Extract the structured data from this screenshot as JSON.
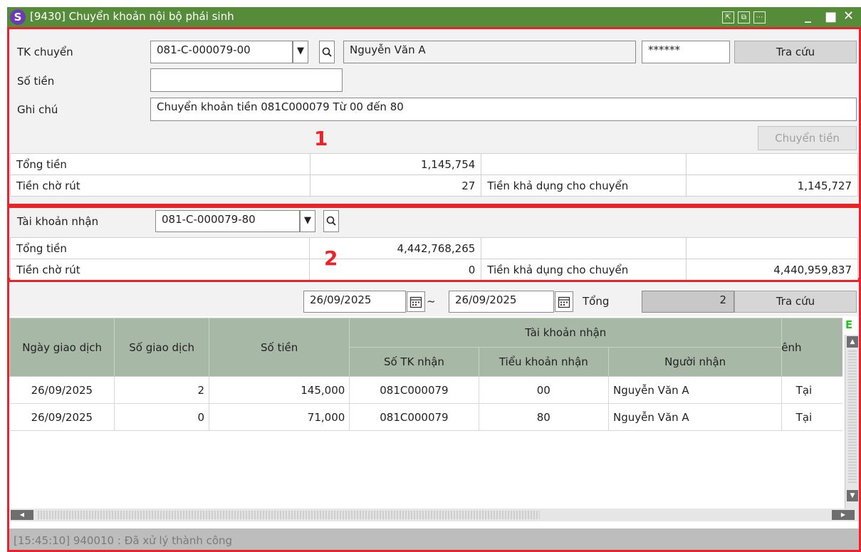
{
  "window": {
    "logo": "S",
    "title": "[9430] Chuyển khoản nội bộ phái sinh",
    "colors": {
      "titlebar": "#568b3a",
      "highlight": "#e8232a",
      "header": "#a8b8a6"
    }
  },
  "section1": {
    "marker": "1",
    "tk_chuyen_label": "TK chuyển",
    "tk_chuyen_value": "081-C-000079-00",
    "name_value": "Nguyễn Văn A",
    "password_value": "******",
    "lookup_button": "Tra cứu",
    "so_tien_label": "Số tiền",
    "so_tien_value": "",
    "ghi_chu_label": "Ghi chú",
    "ghi_chu_value": "Chuyển khoản tiền 081C000079 Từ 00 đến 80",
    "transfer_button": "Chuyển tiền",
    "tong_tien_label": "Tổng tiền",
    "tong_tien_value": "1,145,754",
    "tien_cho_rut_label": "Tiền chờ rút",
    "tien_cho_rut_value": "27",
    "tien_kha_dung_label": "Tiền khả dụng cho chuyển",
    "tien_kha_dung_value": "1,145,727"
  },
  "section2": {
    "marker": "2",
    "tk_nhan_label": "Tài khoản nhận",
    "tk_nhan_value": "081-C-000079-80",
    "tong_tien_label": "Tổng tiền",
    "tong_tien_value": "4,442,768,265",
    "tien_cho_rut_label": "Tiền chờ rút",
    "tien_cho_rut_value": "0",
    "tien_kha_dung_label": "Tiền khả dụng cho chuyển",
    "tien_kha_dung_value": "4,440,959,837"
  },
  "section3": {
    "date_from": "26/09/2025",
    "date_sep": "~",
    "date_to": "26/09/2025",
    "tong_label": "Tổng",
    "tong_value": "2",
    "lookup_button": "Tra cứu",
    "excel_icon_label": "E",
    "headers": {
      "ngay": "Ngày giao dịch",
      "so_gd": "Số giao dịch",
      "so_tien": "Số tiền",
      "group": "Tài khoản nhận",
      "so_tk": "Số TK nhận",
      "tieu_khoan": "Tiểu khoản nhận",
      "nguoi_nhan": "Người nhận",
      "kenh": "Kênh"
    },
    "rows": [
      {
        "ngay": "26/09/2025",
        "so_gd": "2",
        "so_tien": "145,000",
        "so_tk": "081C000079",
        "tieu_khoan": "00",
        "nguoi_nhan": "Nguyễn Văn A",
        "kenh": "Tại"
      },
      {
        "ngay": "26/09/2025",
        "so_gd": "0",
        "so_tien": "71,000",
        "so_tk": "081C000079",
        "tieu_khoan": "80",
        "nguoi_nhan": "Nguyễn Văn A",
        "kenh": "Tại"
      }
    ],
    "status": "[15:45:10] 940010 : Đã xử lý thành công"
  }
}
